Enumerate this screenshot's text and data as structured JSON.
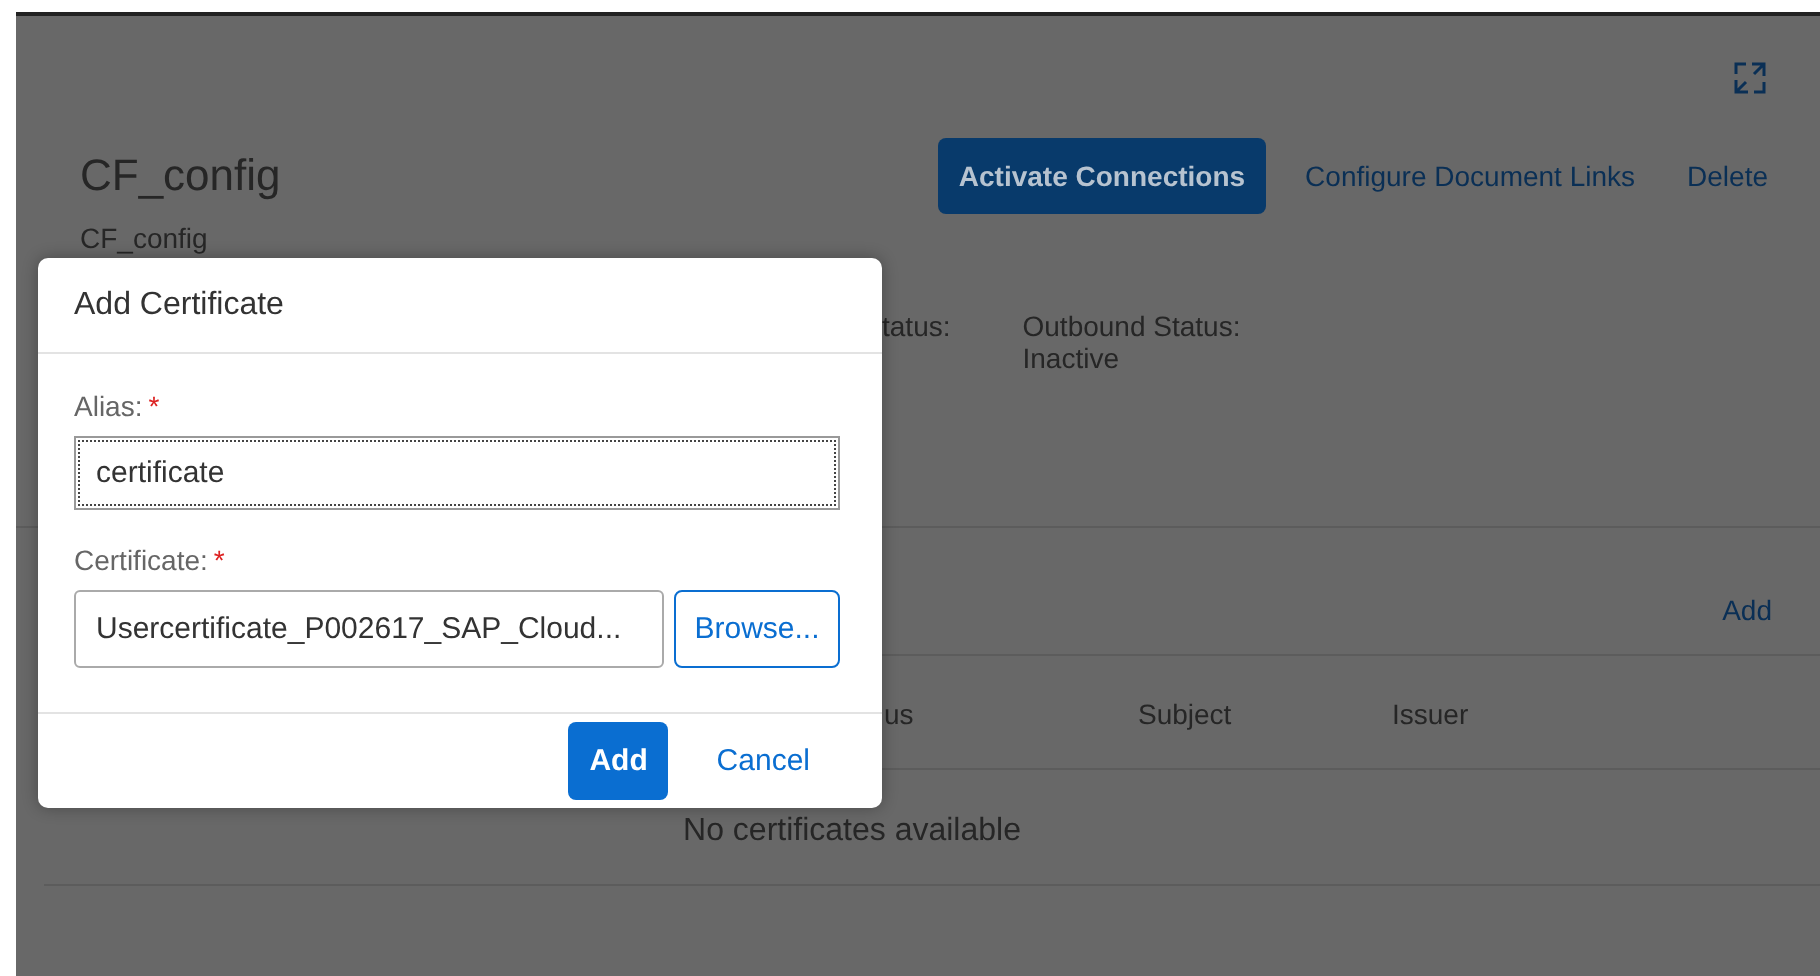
{
  "page": {
    "title": "CF_config",
    "subtitle": "CF_config",
    "actions": [
      {
        "kind": "primary",
        "label": "Activate Connections"
      },
      {
        "kind": "link",
        "label": "Configure Document Links"
      },
      {
        "kind": "link",
        "label": "Delete"
      }
    ],
    "statuses": [
      {
        "label": "tatus:"
      },
      {
        "label": "Outbound Status:",
        "value": "Inactive"
      }
    ],
    "certificates": {
      "add": "Add",
      "columns": [
        "us",
        "Subject",
        "Issuer"
      ],
      "empty": "No certificates available"
    }
  },
  "dialog": {
    "title": "Add Certificate",
    "fields": [
      {
        "kind": "text",
        "label": "Alias:",
        "marker": "*",
        "value": "certificate",
        "focused": true
      },
      {
        "kind": "file",
        "label": "Certificate:",
        "marker": "*",
        "value": "Usercertificate_P002617_SAP_Cloud...",
        "button": "Browse..."
      }
    ],
    "buttons": [
      {
        "kind": "primary",
        "label": "Add"
      },
      {
        "kind": "link",
        "label": "Cancel"
      }
    ]
  }
}
